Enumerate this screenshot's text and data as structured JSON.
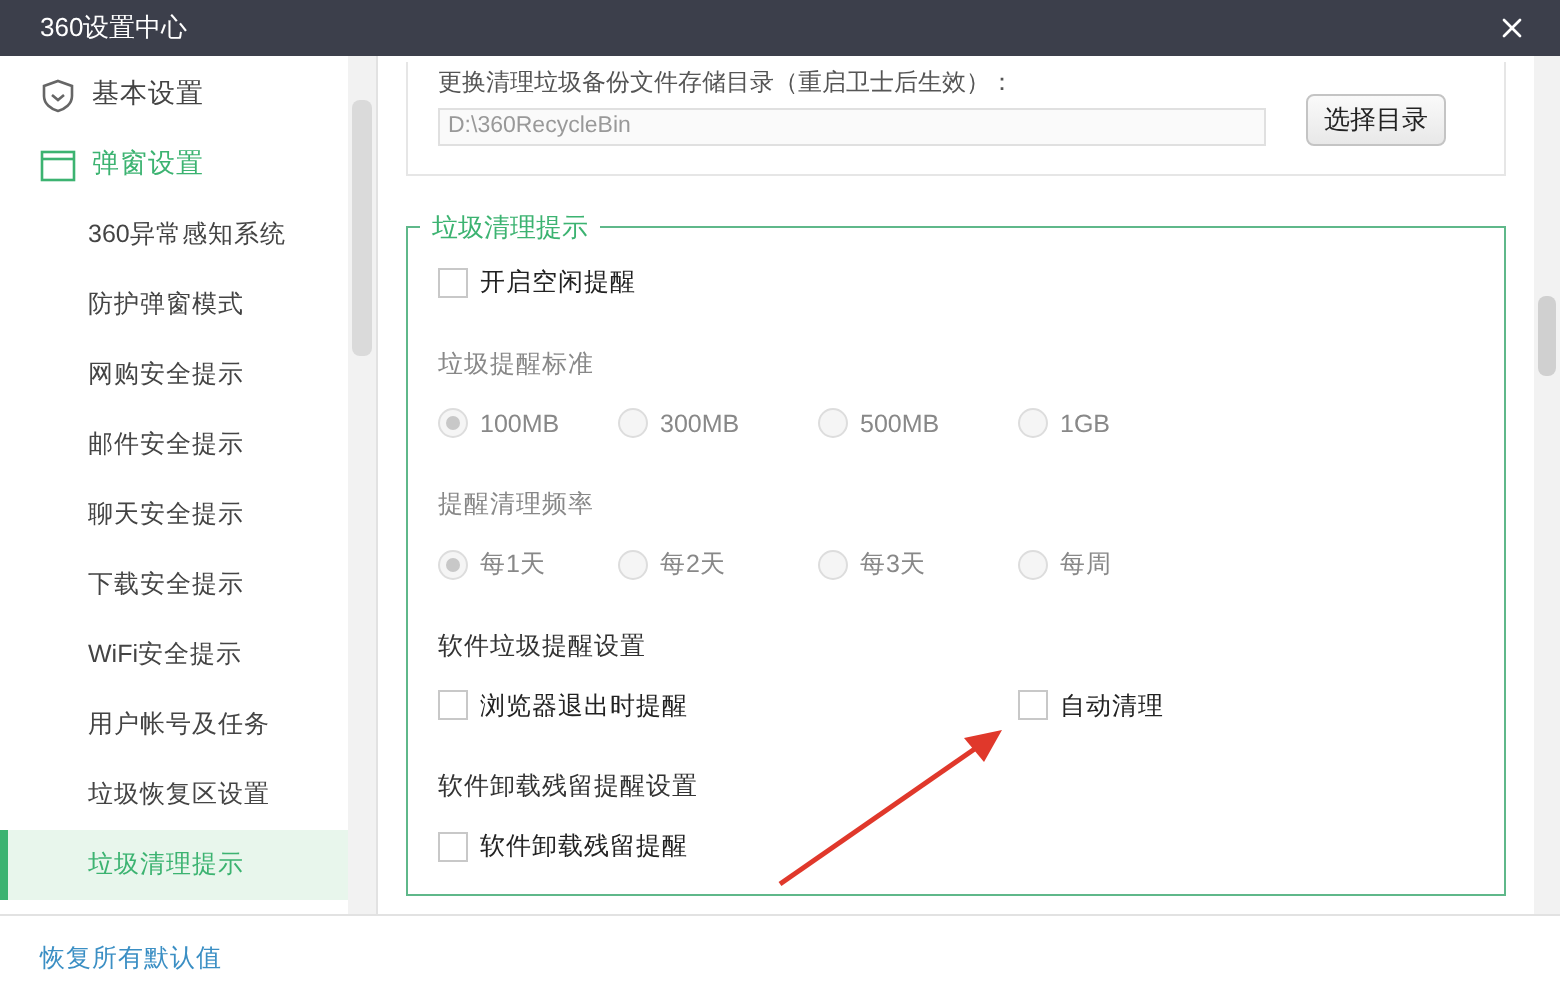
{
  "window": {
    "title": "360设置中心"
  },
  "sidebar": {
    "items": [
      {
        "label": "基本设置",
        "kind": "section",
        "selected": false
      },
      {
        "label": "弹窗设置",
        "kind": "section",
        "selected": false,
        "active": true
      },
      {
        "label": "360异常感知系统",
        "kind": "item",
        "selected": false
      },
      {
        "label": "防护弹窗模式",
        "kind": "item",
        "selected": false
      },
      {
        "label": "网购安全提示",
        "kind": "item",
        "selected": false
      },
      {
        "label": "邮件安全提示",
        "kind": "item",
        "selected": false
      },
      {
        "label": "聊天安全提示",
        "kind": "item",
        "selected": false
      },
      {
        "label": "下载安全提示",
        "kind": "item",
        "selected": false
      },
      {
        "label": "WiFi安全提示",
        "kind": "item",
        "selected": false
      },
      {
        "label": "用户帐号及任务",
        "kind": "item",
        "selected": false
      },
      {
        "label": "垃圾恢复区设置",
        "kind": "item",
        "selected": false
      },
      {
        "label": "垃圾清理提示",
        "kind": "item",
        "selected": true
      }
    ],
    "footer_link": "恢复所有默认值"
  },
  "backup_dir": {
    "label": "更换清理垃圾备份文件存储目录（重启卫士后生效）：",
    "value": "D:\\360RecycleBin",
    "button": "选择目录"
  },
  "group": {
    "title": "垃圾清理提示",
    "idle_reminder": {
      "label": "开启空闲提醒",
      "checked": false
    },
    "sections": [
      {
        "kind": "radio",
        "label": "垃圾提醒标准",
        "disabled": true,
        "options": [
          {
            "label": "100MB",
            "selected": true
          },
          {
            "label": "300MB",
            "selected": false
          },
          {
            "label": "500MB",
            "selected": false
          },
          {
            "label": "1GB",
            "selected": false
          }
        ]
      },
      {
        "kind": "radio",
        "label": "提醒清理频率",
        "disabled": true,
        "options": [
          {
            "label": "每1天",
            "selected": true
          },
          {
            "label": "每2天",
            "selected": false
          },
          {
            "label": "每3天",
            "selected": false
          },
          {
            "label": "每周",
            "selected": false
          }
        ]
      },
      {
        "kind": "checkbox",
        "label": "软件垃圾提醒设置",
        "options": [
          {
            "label": "浏览器退出时提醒",
            "checked": false
          },
          {
            "label": "自动清理",
            "checked": false
          }
        ]
      },
      {
        "kind": "checkbox",
        "label": "软件卸载残留提醒设置",
        "options": [
          {
            "label": "软件卸载残留提醒",
            "checked": false
          }
        ]
      }
    ]
  }
}
